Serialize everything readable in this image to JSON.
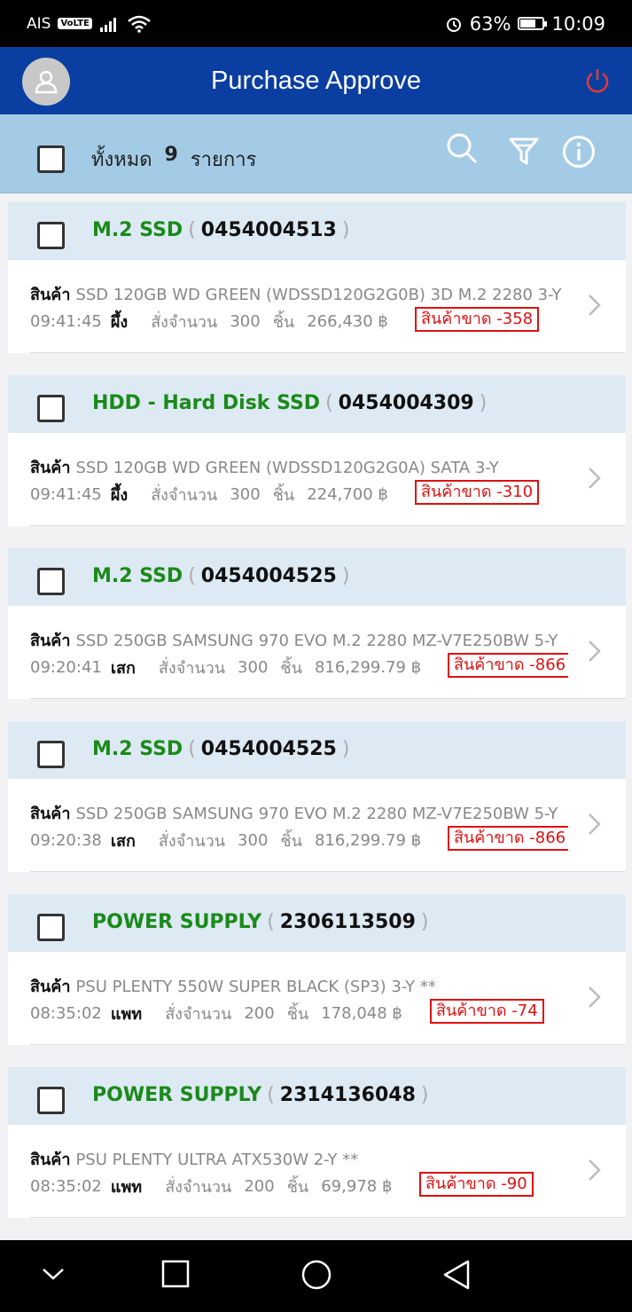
{
  "status_bar": {
    "carrier": "AIS",
    "volte": "VoLTE",
    "battery": "63%",
    "time": "10:09"
  },
  "header": {
    "title": "Purchase Approve"
  },
  "toolbar": {
    "total_label": "ทั้งหมด",
    "total_count": "9",
    "total_unit": "รายการ"
  },
  "labels": {
    "item_label": "สินค้า",
    "qty_label": "สั่งจำนวน",
    "unit": "ชิ้น",
    "paren_open": "(",
    "paren_close": ")"
  },
  "orders": [
    {
      "group": "M.2 SSD",
      "doc_no": "0454004513",
      "product": "SSD 120GB WD GREEN (WDSSD120G2G0B) 3D M.2 2280 3-Y",
      "time": "09:41:45",
      "buyer": "ผึ้ง",
      "qty": "300",
      "amount": "266,430 ฿",
      "shortage": "สินค้าขาด -358"
    },
    {
      "group": "HDD - Hard Disk SSD",
      "doc_no": "0454004309",
      "product": "SSD 120GB WD GREEN (WDSSD120G2G0A) SATA 3-Y",
      "time": "09:41:45",
      "buyer": "ผึ้ง",
      "qty": "300",
      "amount": "224,700 ฿",
      "shortage": "สินค้าขาด -310"
    },
    {
      "group": "M.2 SSD",
      "doc_no": "0454004525",
      "product": "SSD 250GB SAMSUNG 970 EVO M.2 2280 MZ-V7E250BW 5-Y",
      "time": "09:20:41",
      "buyer": "เสก",
      "qty": "300",
      "amount": "816,299.79 ฿",
      "shortage": "สินค้าขาด -866"
    },
    {
      "group": "M.2 SSD",
      "doc_no": "0454004525",
      "product": "SSD 250GB SAMSUNG 970 EVO M.2 2280 MZ-V7E250BW 5-Y",
      "time": "09:20:38",
      "buyer": "เสก",
      "qty": "300",
      "amount": "816,299.79 ฿",
      "shortage": "สินค้าขาด -866"
    },
    {
      "group": "POWER SUPPLY",
      "doc_no": "2306113509",
      "product": "PSU PLENTY 550W SUPER BLACK (SP3) 3-Y **",
      "time": "08:35:02",
      "buyer": "แพท",
      "qty": "200",
      "amount": "178,048 ฿",
      "shortage": "สินค้าขาด -74"
    },
    {
      "group": "POWER SUPPLY",
      "doc_no": "2314136048",
      "product": "PSU PLENTY ULTRA ATX530W 2-Y **",
      "time": "08:35:02",
      "buyer": "แพท",
      "qty": "200",
      "amount": "69,978 ฿",
      "shortage": "สินค้าขาด -90"
    }
  ],
  "colors": {
    "header_bg": "#0a3fa1",
    "toolbar_bg": "#a4cbe6",
    "group_text": "#1a8a1a",
    "shortage": "#d11111",
    "power_icon": "#e53935"
  }
}
